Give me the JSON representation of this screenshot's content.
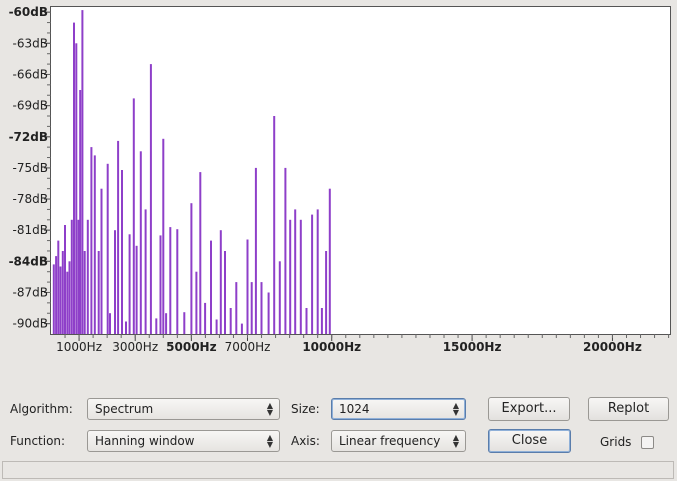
{
  "plot": {
    "y_ticks": [
      {
        "value": -60,
        "label": "-60dB",
        "bold": true
      },
      {
        "value": -63,
        "label": "-63dB",
        "bold": false
      },
      {
        "value": -66,
        "label": "-66dB",
        "bold": false
      },
      {
        "value": -69,
        "label": "-69dB",
        "bold": false
      },
      {
        "value": -72,
        "label": "-72dB",
        "bold": true
      },
      {
        "value": -75,
        "label": "-75dB",
        "bold": false
      },
      {
        "value": -78,
        "label": "-78dB",
        "bold": false
      },
      {
        "value": -81,
        "label": "-81dB",
        "bold": false
      },
      {
        "value": -84,
        "label": "-84dB",
        "bold": true
      },
      {
        "value": -87,
        "label": "-87dB",
        "bold": false
      },
      {
        "value": -90,
        "label": "-90dB",
        "bold": false
      }
    ],
    "x_ticks": [
      {
        "value": 1000,
        "label": "1000Hz",
        "bold": false
      },
      {
        "value": 3000,
        "label": "3000Hz",
        "bold": false
      },
      {
        "value": 5000,
        "label": "5000Hz",
        "bold": true
      },
      {
        "value": 7000,
        "label": "7000Hz",
        "bold": false
      },
      {
        "value": 10000,
        "label": "10000Hz",
        "bold": true
      },
      {
        "value": 15000,
        "label": "15000Hz",
        "bold": true
      },
      {
        "value": 20000,
        "label": "20000Hz",
        "bold": true
      }
    ]
  },
  "chart_data": {
    "type": "bar",
    "xunit": "Hz",
    "yunit": "dB",
    "xlim": [
      0,
      22050
    ],
    "ylim": [
      -91,
      -59.5
    ],
    "grid": false,
    "peaks": [
      {
        "x": 100,
        "y": -84.3
      },
      {
        "x": 180,
        "y": -83.5
      },
      {
        "x": 260,
        "y": -82.0
      },
      {
        "x": 340,
        "y": -84.5
      },
      {
        "x": 420,
        "y": -83.0
      },
      {
        "x": 500,
        "y": -80.5
      },
      {
        "x": 580,
        "y": -85.0
      },
      {
        "x": 660,
        "y": -84.0
      },
      {
        "x": 740,
        "y": -80.0
      },
      {
        "x": 820,
        "y": -61.0
      },
      {
        "x": 900,
        "y": -63.0
      },
      {
        "x": 980,
        "y": -80.0
      },
      {
        "x": 1040,
        "y": -67.5
      },
      {
        "x": 1120,
        "y": -59.8
      },
      {
        "x": 1200,
        "y": -83.0
      },
      {
        "x": 1310,
        "y": -80.0
      },
      {
        "x": 1440,
        "y": -73.0
      },
      {
        "x": 1560,
        "y": -73.8
      },
      {
        "x": 1700,
        "y": -83.0
      },
      {
        "x": 1800,
        "y": -77.0
      },
      {
        "x": 2020,
        "y": -74.6
      },
      {
        "x": 2100,
        "y": -89.0
      },
      {
        "x": 2280,
        "y": -81.0
      },
      {
        "x": 2390,
        "y": -72.4
      },
      {
        "x": 2530,
        "y": -75.2
      },
      {
        "x": 2670,
        "y": -89.8
      },
      {
        "x": 2800,
        "y": -81.4
      },
      {
        "x": 2950,
        "y": -68.3
      },
      {
        "x": 3050,
        "y": -82.5
      },
      {
        "x": 3200,
        "y": -73.4
      },
      {
        "x": 3370,
        "y": -79.0
      },
      {
        "x": 3560,
        "y": -65.0
      },
      {
        "x": 3750,
        "y": -89.5
      },
      {
        "x": 3900,
        "y": -81.5
      },
      {
        "x": 4000,
        "y": -72.2
      },
      {
        "x": 4100,
        "y": -89.0
      },
      {
        "x": 4250,
        "y": -80.7
      },
      {
        "x": 4500,
        "y": -80.9
      },
      {
        "x": 4750,
        "y": -88.9
      },
      {
        "x": 5000,
        "y": -78.4
      },
      {
        "x": 5180,
        "y": -85.0
      },
      {
        "x": 5320,
        "y": -75.4
      },
      {
        "x": 5490,
        "y": -88.0
      },
      {
        "x": 5700,
        "y": -82.0
      },
      {
        "x": 5900,
        "y": -89.6
      },
      {
        "x": 6050,
        "y": -81.0
      },
      {
        "x": 6200,
        "y": -83.0
      },
      {
        "x": 6400,
        "y": -88.5
      },
      {
        "x": 6600,
        "y": -86.0
      },
      {
        "x": 6800,
        "y": -90.0
      },
      {
        "x": 7000,
        "y": -81.9
      },
      {
        "x": 7150,
        "y": -86.0
      },
      {
        "x": 7300,
        "y": -75.0
      },
      {
        "x": 7500,
        "y": -86.0
      },
      {
        "x": 7750,
        "y": -87.0
      },
      {
        "x": 7950,
        "y": -70.0
      },
      {
        "x": 8150,
        "y": -84.0
      },
      {
        "x": 8350,
        "y": -75.0
      },
      {
        "x": 8520,
        "y": -80.0
      },
      {
        "x": 8700,
        "y": -79.0
      },
      {
        "x": 8900,
        "y": -80.0
      },
      {
        "x": 9100,
        "y": -88.5
      },
      {
        "x": 9300,
        "y": -79.5
      },
      {
        "x": 9500,
        "y": -79.0
      },
      {
        "x": 9650,
        "y": -88.5
      },
      {
        "x": 9800,
        "y": -83.0
      },
      {
        "x": 9930,
        "y": -77.0
      }
    ]
  },
  "controls": {
    "algorithm_label": "Algorithm:",
    "algorithm_value": "Spectrum",
    "size_label": "Size:",
    "size_value": "1024",
    "export_button": "Export...",
    "replot_button": "Replot",
    "function_label": "Function:",
    "function_value": "Hanning window",
    "axis_label": "Axis:",
    "axis_value": "Linear frequency",
    "close_button": "Close",
    "grids_label": "Grids",
    "grids_checked": false
  },
  "colors": {
    "bar": "#8e3fc9",
    "plot_bg": "#ffffff"
  }
}
